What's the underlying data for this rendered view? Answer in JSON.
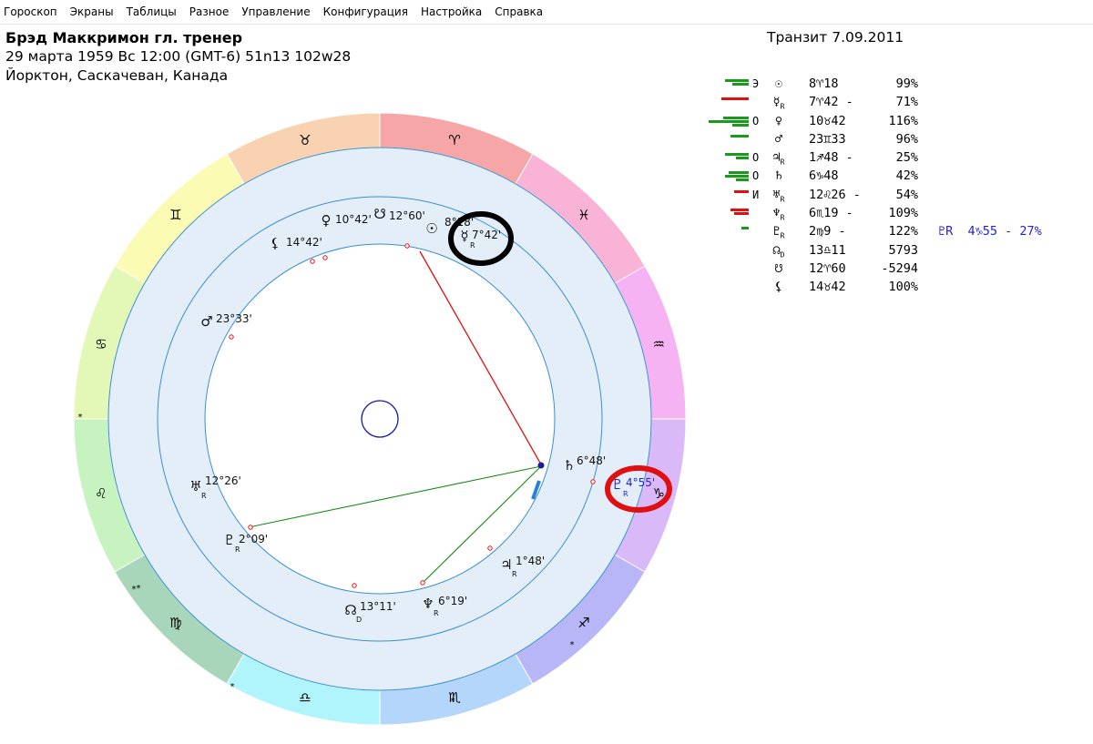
{
  "menu": [
    "Гороскоп",
    "Экраны",
    "Таблицы",
    "Разное",
    "Управление",
    "Конфигурация",
    "Настройка",
    "Справка"
  ],
  "header": {
    "title": "Брэд Маккримон гл. тренер",
    "line2": "29 марта 1959  Вс  12:00 (GMT-6) 51n13  102w28",
    "line3": "Йорктон, Саскачеван, Канада",
    "transit": "Транзит  7.09.2011"
  },
  "planets": [
    {
      "flag": "Э",
      "glyph": "☉",
      "sub": "",
      "pos": "8♈18",
      "pct": "99%",
      "bar_color": "#1a9a1a",
      "bars": [
        26,
        18
      ]
    },
    {
      "flag": "",
      "glyph": "☿",
      "sub": "R",
      "pos": "7♈42 -",
      "pct": "71%",
      "bar_color": "#e01010",
      "bars": [
        30
      ]
    },
    {
      "flag": "О",
      "glyph": "♀",
      "sub": "",
      "pos": "10♉42",
      "pct": "116%",
      "bar_color": "#1a9a1a",
      "bars": [
        28,
        44,
        18
      ]
    },
    {
      "flag": "",
      "glyph": "♂",
      "sub": "",
      "pos": "23♊33",
      "pct": "96%",
      "bar_color": "#1a9a1a",
      "bars": [
        20
      ]
    },
    {
      "flag": "О",
      "glyph": "♃",
      "sub": "R",
      "pos": "1♐48 -",
      "pct": "25%",
      "bar_color": "#1a9a1a",
      "bars": [
        26,
        14
      ]
    },
    {
      "flag": "О",
      "glyph": "♄",
      "sub": "",
      "pos": "6♑48",
      "pct": "42%",
      "bar_color": "#1a9a1a",
      "bars": [
        22,
        26,
        14
      ]
    },
    {
      "flag": "И",
      "glyph": "♅",
      "sub": "R",
      "pos": "12♌26 -",
      "pct": "54%",
      "bar_color": "#e01010",
      "bars": [
        16
      ]
    },
    {
      "flag": "",
      "glyph": "♆",
      "sub": "R",
      "pos": "6♏19 -",
      "pct": "109%",
      "bar_color": "#e01010",
      "bars": [
        20,
        16
      ]
    },
    {
      "flag": "",
      "glyph": "♇",
      "sub": "R",
      "pos": "2♍9 -",
      "pct": "122%",
      "bar_color": "#1a9a1a",
      "bars": [
        8
      ]
    },
    {
      "flag": "",
      "glyph": "☊",
      "sub": "D",
      "pos": "13♎11",
      "pct": "5793",
      "bar_color": "",
      "bars": []
    },
    {
      "flag": "",
      "glyph": "☋",
      "sub": "",
      "pos": "12♈60",
      "pct": "-5294",
      "bar_color": "",
      "bars": []
    },
    {
      "flag": "",
      "glyph": "⚸",
      "sub": "",
      "pos": "14♉42",
      "pct": "100%",
      "bar_color": "",
      "bars": []
    }
  ],
  "transit_extra": "♇R  4♑55 - 27%",
  "zodiac": [
    {
      "glyph": "♈",
      "color": "#f6a6a6"
    },
    {
      "glyph": "♉",
      "color": "#f9d3b1"
    },
    {
      "glyph": "♊",
      "color": "#fbfbb4"
    },
    {
      "glyph": "♋",
      "color": "#e3f8b7"
    },
    {
      "glyph": "♌",
      "color": "#c7f3c1"
    },
    {
      "glyph": "♍",
      "color": "#a7d6bb"
    },
    {
      "glyph": "♎",
      "color": "#aff5fb"
    },
    {
      "glyph": "♏",
      "color": "#b5d6fb"
    },
    {
      "glyph": "♐",
      "color": "#b9b6f7"
    },
    {
      "glyph": "♑",
      "color": "#d9b9f8"
    },
    {
      "glyph": "♒",
      "color": "#f6b3f3"
    },
    {
      "glyph": "♓",
      "color": "#f9b3d7"
    }
  ],
  "chart_planets": [
    {
      "name": "venus",
      "glyph": "♀",
      "label": "10°42'"
    },
    {
      "name": "node-south",
      "glyph": "☋",
      "label": "12°60'"
    },
    {
      "name": "sun",
      "glyph": "☉",
      "label": "8°18'"
    },
    {
      "name": "mercury",
      "glyph": "☿",
      "sub": "R",
      "label": "7°42'"
    },
    {
      "name": "lilith",
      "glyph": "⚸",
      "label": "14°42'"
    },
    {
      "name": "mars",
      "glyph": "♂",
      "label": "23°33'"
    },
    {
      "name": "uranus",
      "glyph": "♅",
      "sub": "R",
      "label": "12°26'"
    },
    {
      "name": "pluto",
      "glyph": "♇",
      "sub": "R",
      "label": "2°09'"
    },
    {
      "name": "node-north",
      "glyph": "☊",
      "sub": "D",
      "label": "13°11'"
    },
    {
      "name": "neptune",
      "glyph": "♆",
      "sub": "R",
      "label": "6°19'"
    },
    {
      "name": "jupiter",
      "glyph": "♃",
      "sub": "R",
      "label": "1°48'"
    },
    {
      "name": "saturn",
      "glyph": "♄",
      "label": "6°48'"
    },
    {
      "name": "transit-pluto",
      "glyph": "♇",
      "sub": "R",
      "label": "4°55'"
    }
  ],
  "colors": {
    "ring": "#e4eef8",
    "ring_stroke": "#3b8fd0",
    "aspect_red": "#e01010",
    "aspect_green": "#1a8a1a",
    "transit": "#2323d0"
  }
}
